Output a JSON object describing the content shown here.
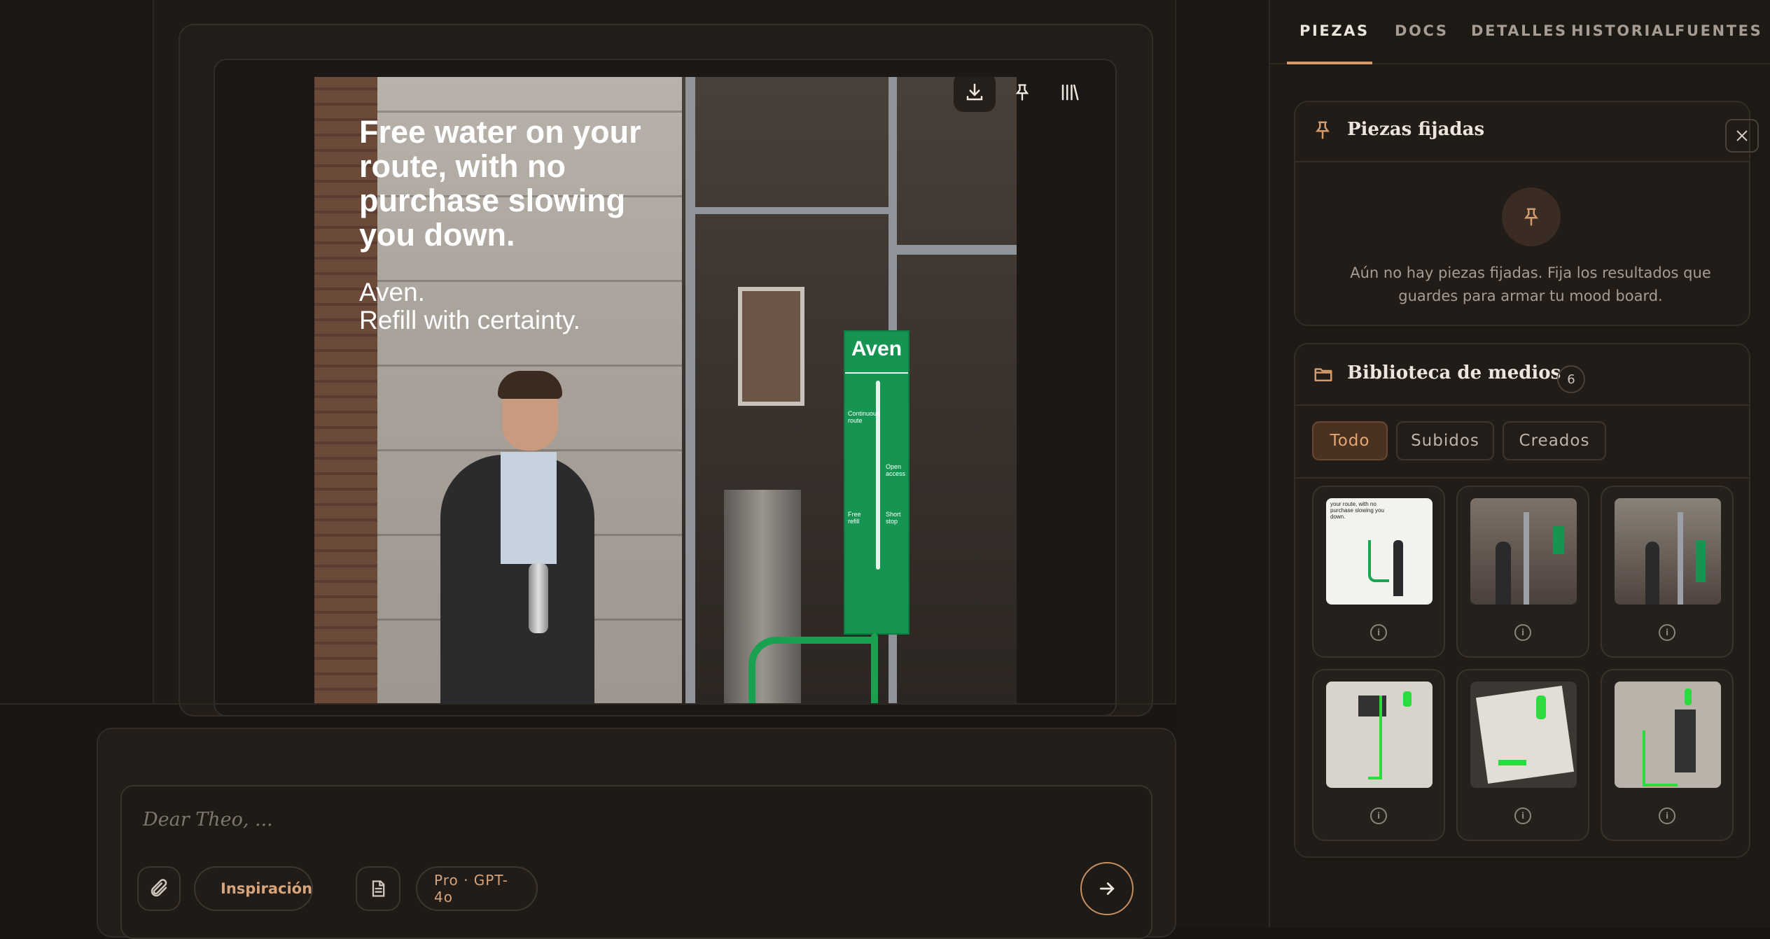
{
  "ad": {
    "headline": "Free water on your route, with no purchase slowing you down.",
    "tagline_line1": "Aven.",
    "tagline_line2": "Refill with certainty.",
    "sign_logo": "Aven",
    "sign_labels": [
      "Continuous route",
      "Open access",
      "Free refill",
      "Short stop"
    ]
  },
  "toolbar": {
    "icons": [
      "download-icon",
      "pin-icon",
      "library-icon"
    ]
  },
  "composer": {
    "placeholder": "Dear Theo, ...",
    "inspiration_label": "Inspiración",
    "model_label": "Pro · GPT-4o"
  },
  "panel": {
    "tabs": [
      "PIEZAS",
      "DOCS",
      "DETALLES",
      "HISTORIAL",
      "FUENTES"
    ],
    "active_tab": "PIEZAS",
    "pinned": {
      "title": "Piezas fijadas",
      "empty_text": "Aún no hay piezas fijadas. Fija los resultados que guardes para armar tu mood board."
    },
    "library": {
      "title": "Biblioteca de medios",
      "count": "6",
      "filters": [
        "Todo",
        "Subidos",
        "Creados"
      ],
      "active_filter": "Todo",
      "thumbs": [
        {
          "kind": "poster-text",
          "caption": "your route, with no purchase slowing you down."
        },
        {
          "kind": "street-scene",
          "caption": ""
        },
        {
          "kind": "street-scene",
          "caption": ""
        },
        {
          "kind": "sketch",
          "caption": ""
        },
        {
          "kind": "sketch-tilted",
          "caption": ""
        },
        {
          "kind": "sketch-hand",
          "caption": ""
        }
      ]
    }
  },
  "colors": {
    "accent": "#d39a6c",
    "brand_green": "#159551",
    "bg": "#1a1613"
  }
}
